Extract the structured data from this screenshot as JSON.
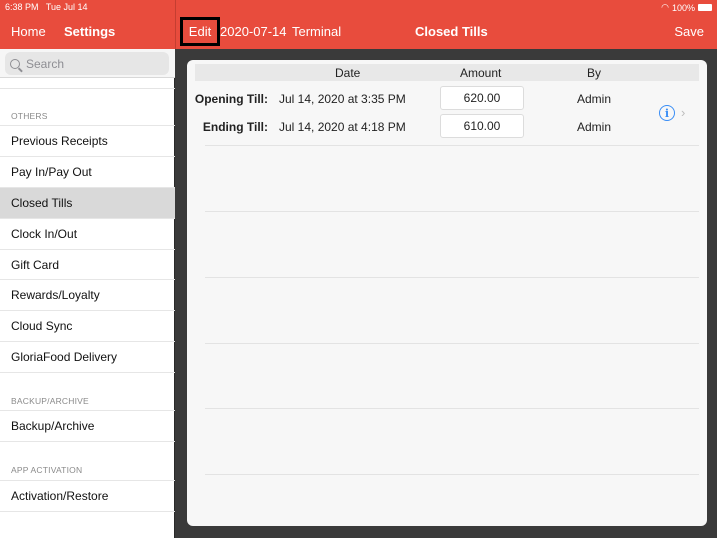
{
  "status_bar": {
    "time": "6:38 PM",
    "date": "Tue Jul 14",
    "battery": "100%"
  },
  "nav": {
    "home": "Home",
    "settings": "Settings",
    "edit": "Edit",
    "date": "2020-07-14",
    "terminal": "Terminal",
    "title": "Closed Tills",
    "save": "Save"
  },
  "sidebar": {
    "search_placeholder": "Search",
    "sections": [
      {
        "label": "OTHERS",
        "items": [
          "Previous Receipts",
          "Pay In/Pay Out",
          "Closed Tills",
          "Clock In/Out",
          "Gift Card",
          "Rewards/Loyalty",
          "Cloud Sync",
          "GloriaFood Delivery"
        ]
      },
      {
        "label": "BACKUP/ARCHIVE",
        "items": [
          "Backup/Archive"
        ]
      },
      {
        "label": "APP ACTIVATION",
        "items": [
          "Activation/Restore"
        ]
      }
    ],
    "selected": "Closed Tills"
  },
  "table": {
    "headers": {
      "date": "Date",
      "amount": "Amount",
      "by": "By"
    },
    "rows": [
      {
        "label": "Opening Till:",
        "date": "Jul 14, 2020 at 3:35 PM",
        "amount": "620.00",
        "by": "Admin"
      },
      {
        "label": "Ending Till:",
        "date": "Jul 14, 2020 at 4:18 PM",
        "amount": "610.00",
        "by": "Admin"
      }
    ],
    "info_icon": "i",
    "chevron": "›"
  },
  "colors": {
    "accent": "#e84c3d",
    "info": "#3a8ef6"
  }
}
